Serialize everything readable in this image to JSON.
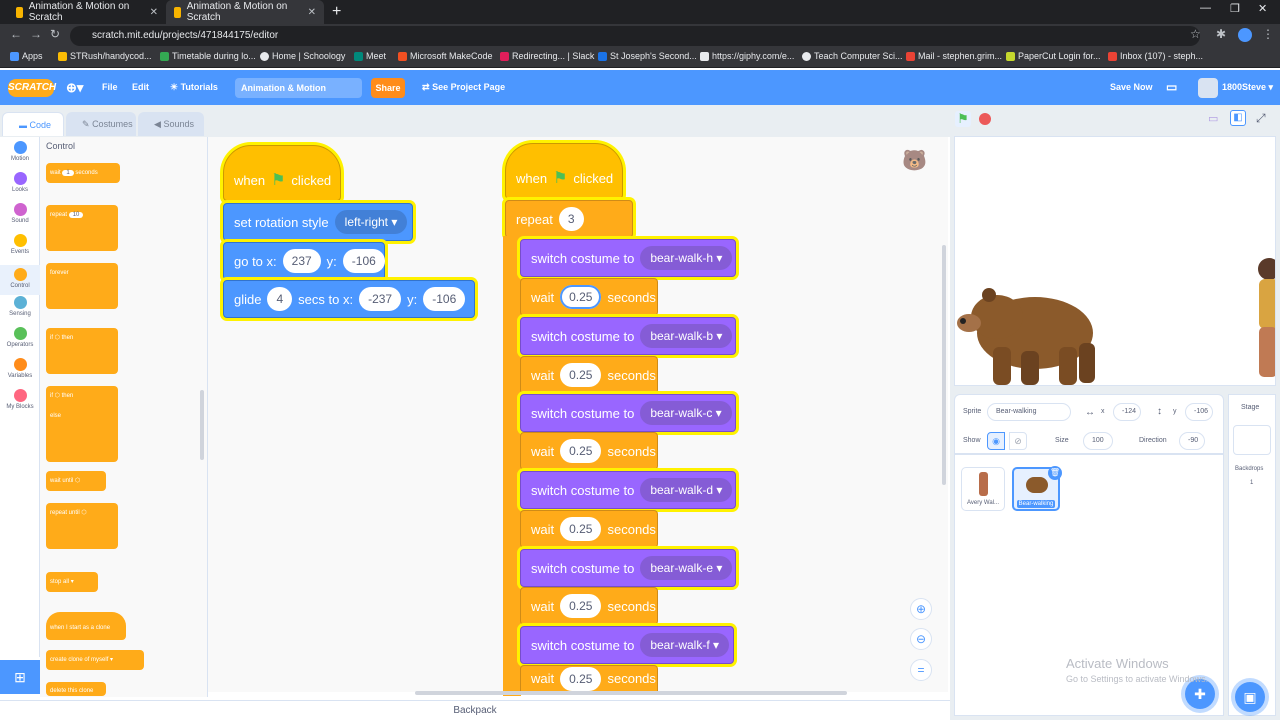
{
  "browser": {
    "tabs": [
      {
        "label": "Animation & Motion on Scratch",
        "active": false
      },
      {
        "label": "Animation & Motion on Scratch",
        "active": true
      }
    ],
    "url": "scratch.mit.edu/projects/471844175/editor",
    "bookmarks": [
      "Apps",
      "STRush/handycod...",
      "Timetable during lo...",
      "Home | Schoology",
      "Meet",
      "Microsoft MakeCode",
      "Redirecting... | Slack",
      "St Joseph's Second...",
      "https://giphy.com/e...",
      "Teach Computer Sci...",
      "Mail - stephen.grim...",
      "PaperCut Login for...",
      "Inbox (107) - steph..."
    ]
  },
  "menubar": {
    "logo": "SCRATCH",
    "file": "File",
    "edit": "Edit",
    "tutorials": "Tutorials",
    "project_title": "Animation & Motion",
    "share": "Share",
    "see_project": "See Project Page",
    "save_now": "Save Now",
    "username": "1800Steve",
    "accent": "#4c97ff"
  },
  "editor_tabs": {
    "code": "Code",
    "costumes": "Costumes",
    "sounds": "Sounds"
  },
  "categories": [
    {
      "label": "Motion",
      "color": "#4c97ff"
    },
    {
      "label": "Looks",
      "color": "#9966ff"
    },
    {
      "label": "Sound",
      "color": "#cf63cf"
    },
    {
      "label": "Events",
      "color": "#ffbf00"
    },
    {
      "label": "Control",
      "color": "#ffab19"
    },
    {
      "label": "Sensing",
      "color": "#5cb1d6"
    },
    {
      "label": "Operators",
      "color": "#59c059"
    },
    {
      "label": "Variables",
      "color": "#ff8c1a"
    },
    {
      "label": "My Blocks",
      "color": "#ff6680"
    }
  ],
  "palette": {
    "title": "Control",
    "wait": "wait",
    "wait_val": "1",
    "seconds": "seconds",
    "repeat": "repeat",
    "repeat_val": "10",
    "forever": "forever",
    "if": "if",
    "then": "then",
    "else": "else",
    "wait_until": "wait until",
    "repeat_until": "repeat until",
    "stop": "stop",
    "stop_val": "all",
    "clone_start": "when I start as a clone",
    "create_clone": "create clone of",
    "create_clone_val": "myself",
    "delete_clone": "delete this clone"
  },
  "script1": {
    "when": "when",
    "clicked": "clicked",
    "rot_label": "set rotation style",
    "rot_val": "left-right",
    "goto_label": "go to x:",
    "goto_x": "237",
    "y_label": "y:",
    "goto_y": "-106",
    "glide_label": "glide",
    "glide_secs": "4",
    "glide_mid": "secs to x:",
    "glide_x": "-237",
    "glide_y": "-106"
  },
  "script2": {
    "when": "when",
    "clicked": "clicked",
    "repeat": "repeat",
    "repeat_val": "3",
    "switch_label": "switch costume to",
    "wait": "wait",
    "seconds": "seconds",
    "steps": [
      {
        "costume": "bear-walk-h",
        "wait": "0.25"
      },
      {
        "costume": "bear-walk-b",
        "wait": "0.25"
      },
      {
        "costume": "bear-walk-c",
        "wait": "0.25"
      },
      {
        "costume": "bear-walk-d",
        "wait": "0.25"
      },
      {
        "costume": "bear-walk-e",
        "wait": "0.25"
      },
      {
        "costume": "bear-walk-f",
        "wait": "0.25"
      }
    ]
  },
  "backpack": "Backpack",
  "sprite_info": {
    "sprite_label": "Sprite",
    "sprite_name": "Bear-walking",
    "x_label": "x",
    "x": "-124",
    "y_label": "y",
    "y": "-106",
    "show_label": "Show",
    "size_label": "Size",
    "size": "100",
    "direction_label": "Direction",
    "direction": "-90"
  },
  "sprites": [
    {
      "name": "Avery Wal...",
      "selected": false
    },
    {
      "name": "Bear-walking",
      "selected": true
    }
  ],
  "stage_panel": {
    "label": "Stage",
    "backdrops_label": "Backdrops",
    "backdrops_count": "1"
  },
  "watermark": {
    "title": "Activate Windows",
    "sub": "Go to Settings to activate Windows."
  }
}
